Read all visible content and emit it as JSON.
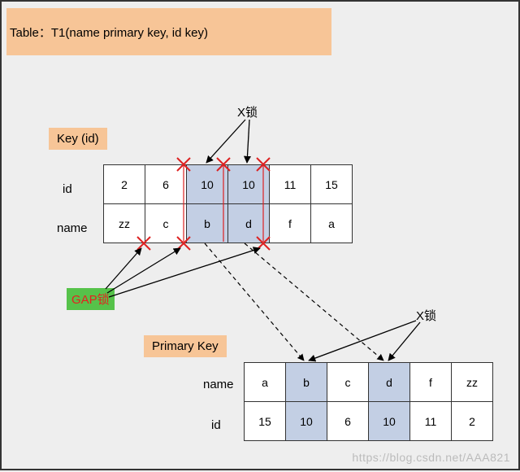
{
  "title": "Table：T1(name primary key, id key)",
  "key_label": "Key (id)",
  "primary_key_label": "Primary Key",
  "gap_label": "GAP锁",
  "xlock_label_top": "X锁",
  "xlock_label_bottom": "X锁",
  "row_headers": {
    "top_id": "id",
    "top_name": "name",
    "bottom_name": "name",
    "bottom_id": "id"
  },
  "top_table": {
    "id": [
      "2",
      "6",
      "10",
      "10",
      "11",
      "15"
    ],
    "name": [
      "zz",
      "c",
      "b",
      "d",
      "f",
      "a"
    ],
    "highlight": [
      false,
      false,
      true,
      true,
      false,
      false
    ]
  },
  "bottom_table": {
    "name": [
      "a",
      "b",
      "c",
      "d",
      "f",
      "zz"
    ],
    "id": [
      "15",
      "10",
      "6",
      "10",
      "11",
      "2"
    ],
    "highlight": [
      false,
      true,
      false,
      true,
      false,
      false
    ]
  },
  "watermark": "https://blog.csdn.net/AAA821"
}
